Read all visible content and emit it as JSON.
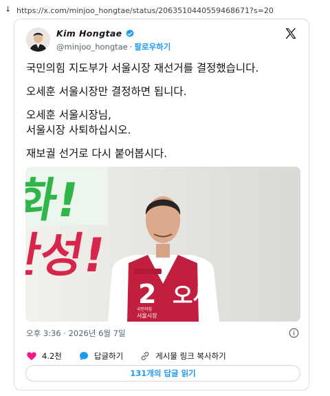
{
  "browser": {
    "url": "https://x.com/minjoo_hongtae/status/2063510440559468671?s=20"
  },
  "tweet": {
    "author_name": "Kim Hongtae",
    "handle": "@minjoo_hongtae",
    "separator": "·",
    "follow_label": "팔로우하기",
    "paragraphs": [
      "국민의힘 지도부가 서울시장 재선거를 결정했습니다.",
      "오세훈 서울시장만 결정하면 됩니다.",
      "오세훈 서울시장님,\n서울시장 사퇴하십시오.",
      "재보궐 선거로 다시 붙어봅시다."
    ],
    "media": {
      "banner_top_text": "화!",
      "banner_mid_text": "안성!",
      "vest_number": "2",
      "vest_name": "오세",
      "vest_small_party": "국민의힘",
      "vest_small_title": "서울시장"
    },
    "timestamp": "오후 3:36 · 2026년 6월 7일",
    "likes": "4.2천",
    "reply_label": "답글하기",
    "copy_link_label": "게시물 링크 복사하기",
    "read_replies_label": "131개의 답글 읽기"
  },
  "colors": {
    "brand_blue": "#1d9bf0",
    "like_pink": "#f91880",
    "vest_red": "#c21f3f",
    "banner_green": "#2fb54a"
  },
  "icons": [
    "download-arrow-icon",
    "verified-badge-icon",
    "x-logo-icon",
    "info-icon",
    "heart-icon",
    "reply-bubble-icon",
    "link-icon"
  ]
}
